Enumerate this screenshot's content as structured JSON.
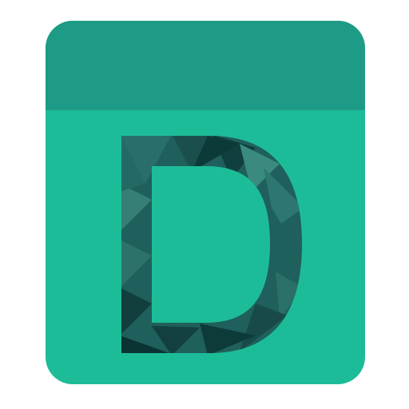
{
  "app_icon": {
    "letter": "D",
    "icon_name": "letter-d-app-icon",
    "colors": {
      "background": "#ffffff",
      "header": "#1e9b86",
      "body": "#1dbc98",
      "letter_dark": "#0c3b3a",
      "letter_mid": "#1f5f5c",
      "letter_light": "#2f7a73"
    }
  }
}
